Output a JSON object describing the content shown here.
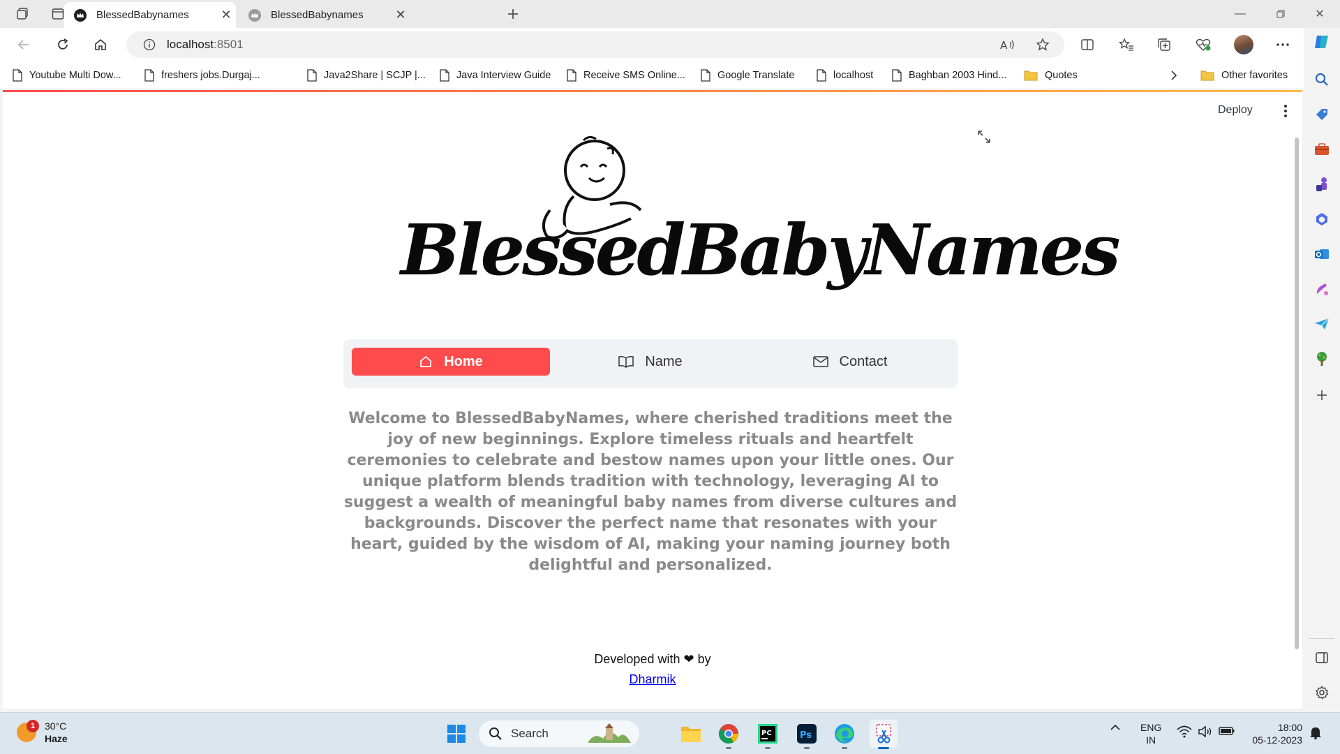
{
  "browser": {
    "tabs": [
      {
        "title": "BlessedBabynames",
        "active": true
      },
      {
        "title": "BlessedBabynames",
        "active": false
      }
    ],
    "address": {
      "host": "localhost",
      "port": ":8501"
    },
    "bookmarks": [
      {
        "label": "Youtube Multi Dow...",
        "icon": "page-icon"
      },
      {
        "label": "freshers jobs.Durgaj...",
        "icon": "page-icon"
      },
      {
        "label": "Java2Share | SCJP |...",
        "icon": "page-icon"
      },
      {
        "label": "Java Interview Guide",
        "icon": "page-icon"
      },
      {
        "label": "Receive SMS Online...",
        "icon": "page-icon"
      },
      {
        "label": "Google Translate",
        "icon": "page-icon"
      },
      {
        "label": "localhost",
        "icon": "page-icon"
      },
      {
        "label": "Baghban 2003 Hind...",
        "icon": "page-icon"
      },
      {
        "label": "Quotes",
        "icon": "folder-icon"
      }
    ],
    "other_favorites": "Other favorites"
  },
  "app": {
    "deploy_label": "Deploy",
    "logo_text": "BlessedBabyNames",
    "nav": [
      {
        "label": "Home",
        "icon": "home-icon",
        "active": true
      },
      {
        "label": "Name",
        "icon": "book-icon",
        "active": false
      },
      {
        "label": "Contact",
        "icon": "envelope-icon",
        "active": false
      }
    ],
    "intro": "Welcome to BlessedBabyNames, where cherished traditions meet the joy of new beginnings. Explore timeless rituals and heartfelt ceremonies to celebrate and bestow names upon your little ones. Our unique platform blends tradition with technology, leveraging AI to suggest a wealth of meaningful baby names from diverse cultures and backgrounds. Discover the perfect name that resonates with your heart, guided by the wisdom of AI, making your naming journey both delightful and personalized.",
    "footer": {
      "prefix": "Developed with",
      "heart": "❤",
      "suffix": "by",
      "author": "Dharmik"
    },
    "colors": {
      "accent": "#ff4b4b",
      "nav_bg": "#f0f2f6",
      "intro_text": "#8a8a8a"
    }
  },
  "taskbar": {
    "weather": {
      "badge": "1",
      "temp": "30°C",
      "condition": "Haze"
    },
    "search_placeholder": "Search",
    "language": {
      "line1": "ENG",
      "line2": "IN"
    },
    "clock": {
      "time": "18:00",
      "date": "05-12-2023"
    }
  }
}
